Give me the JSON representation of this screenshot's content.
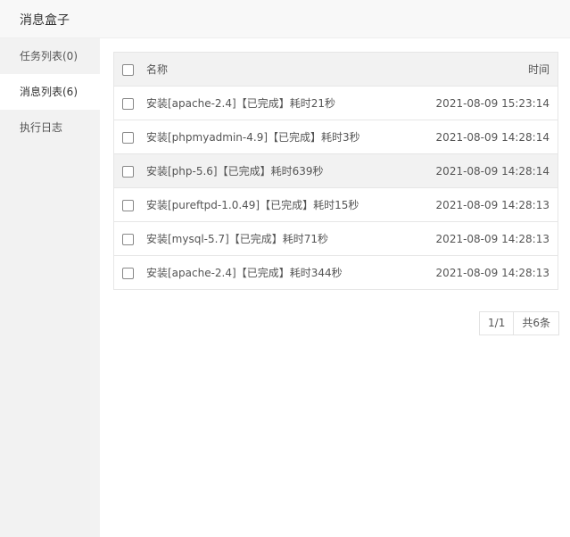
{
  "window": {
    "title": "消息盒子"
  },
  "sidebar": {
    "items": [
      {
        "label": "任务列表(0)"
      },
      {
        "label": "消息列表(6)"
      },
      {
        "label": "执行日志"
      }
    ]
  },
  "table": {
    "headers": {
      "name": "名称",
      "time": "时间"
    },
    "rows": [
      {
        "name": "安装[apache-2.4]【已完成】耗时21秒",
        "time": "2021-08-09 15:23:14"
      },
      {
        "name": "安装[phpmyadmin-4.9]【已完成】耗时3秒",
        "time": "2021-08-09 14:28:14"
      },
      {
        "name": "安装[php-5.6]【已完成】耗时639秒",
        "time": "2021-08-09 14:28:14"
      },
      {
        "name": "安装[pureftpd-1.0.49]【已完成】耗时15秒",
        "time": "2021-08-09 14:28:13"
      },
      {
        "name": "安装[mysql-5.7]【已完成】耗时71秒",
        "time": "2021-08-09 14:28:13"
      },
      {
        "name": "安装[apache-2.4]【已完成】耗时344秒",
        "time": "2021-08-09 14:28:13"
      }
    ]
  },
  "pagination": {
    "page": "1/1",
    "total": "共6条"
  }
}
